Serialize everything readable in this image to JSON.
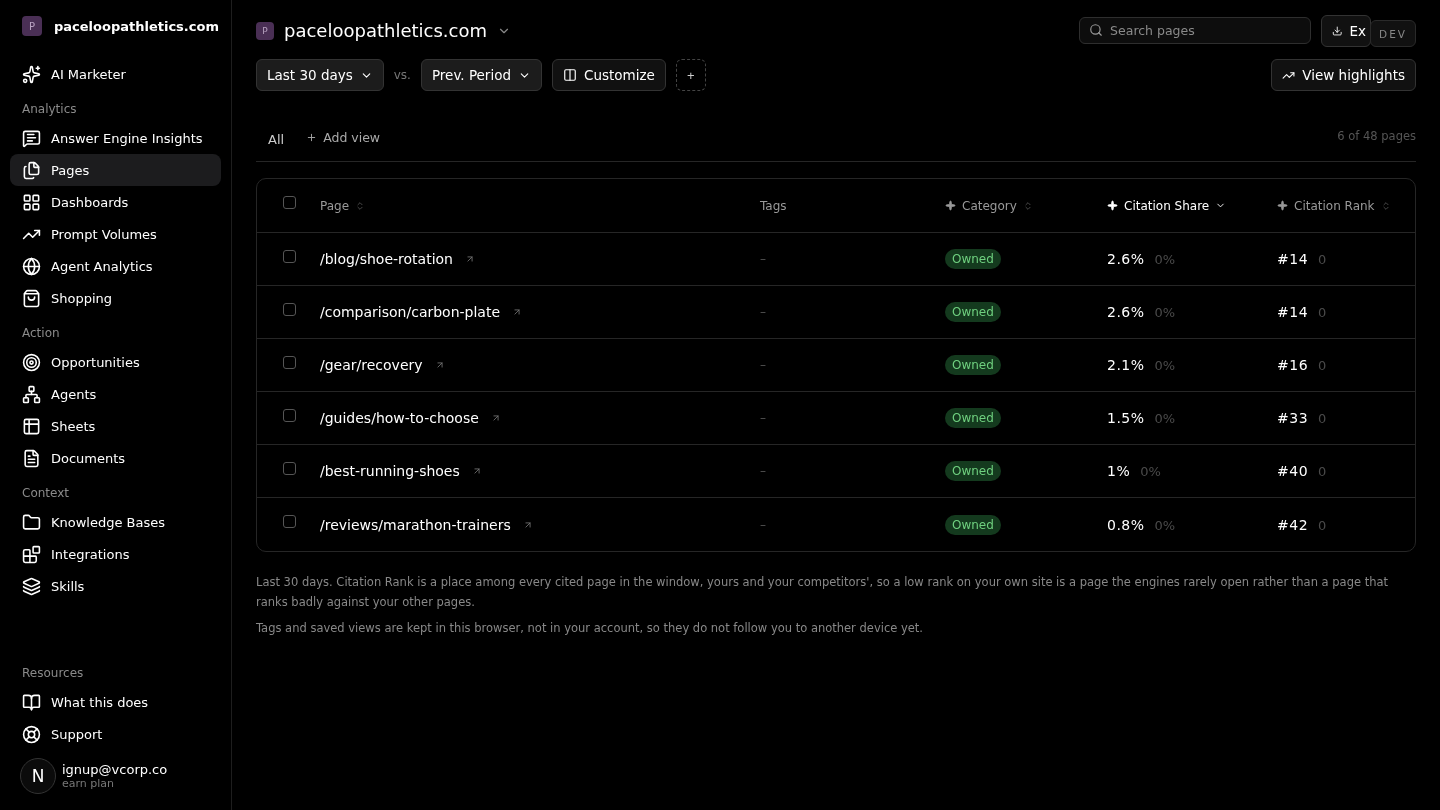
{
  "sidebar": {
    "workspace": {
      "initial": "P",
      "name": "paceloopathletics.com"
    },
    "top_item": {
      "label": "AI Marketer",
      "selected": false
    },
    "sections": [
      {
        "title": "Analytics",
        "items": [
          {
            "label": "Answer Engine Insights",
            "selected": false
          },
          {
            "label": "Pages",
            "selected": true
          },
          {
            "label": "Dashboards",
            "selected": false
          },
          {
            "label": "Prompt Volumes",
            "selected": false
          },
          {
            "label": "Agent Analytics",
            "selected": false
          },
          {
            "label": "Shopping",
            "selected": false
          }
        ]
      },
      {
        "title": "Action",
        "items": [
          {
            "label": "Opportunities",
            "selected": false
          },
          {
            "label": "Agents",
            "selected": false
          },
          {
            "label": "Sheets",
            "selected": false
          },
          {
            "label": "Documents",
            "selected": false
          }
        ]
      },
      {
        "title": "Context",
        "items": [
          {
            "label": "Knowledge Bases",
            "selected": false
          },
          {
            "label": "Integrations",
            "selected": false
          },
          {
            "label": "Skills",
            "selected": false
          }
        ]
      },
      {
        "title": "Resources",
        "items": [
          {
            "label": "What this does",
            "selected": false
          },
          {
            "label": "Support",
            "selected": false
          }
        ]
      }
    ],
    "user": {
      "avatar": "N",
      "email": "ignup@vcorp.co",
      "plan": "earn plan"
    }
  },
  "header": {
    "site_initial": "P",
    "site": "paceloopathletics.com",
    "search": {
      "placeholder": "Search pages"
    },
    "export_button": "Ex",
    "dev_badge": "DEV"
  },
  "toolbar": {
    "period": "Last 30 days",
    "vs": "vs.",
    "compare": "Prev. Period",
    "customize": "Customize",
    "add": "+",
    "highlights": "View highlights"
  },
  "views": {
    "tabs": [
      {
        "label": "All",
        "selected": true
      }
    ],
    "add_view": "Add view",
    "count": "6 of 48 pages"
  },
  "table": {
    "select_all": {
      "checked": false
    },
    "columns": [
      {
        "label": "Page",
        "kind": "sortable",
        "selected": false
      },
      {
        "label": "Tags",
        "kind": "plain",
        "selected": false
      },
      {
        "label": "Category",
        "kind": "metric",
        "selected": false
      },
      {
        "label": "Citation Share",
        "kind": "metric",
        "selected": true
      },
      {
        "label": "Citation Rank",
        "kind": "metric",
        "selected": false
      }
    ],
    "rows": [
      {
        "checked": false,
        "page": "/blog/shoe-rotation",
        "tags": "–",
        "category": "Owned",
        "share": "2.6%",
        "share_change": "0%",
        "rank": "#14",
        "rank_change": "0"
      },
      {
        "checked": false,
        "page": "/comparison/carbon-plate",
        "tags": "–",
        "category": "Owned",
        "share": "2.6%",
        "share_change": "0%",
        "rank": "#14",
        "rank_change": "0"
      },
      {
        "checked": false,
        "page": "/gear/recovery",
        "tags": "–",
        "category": "Owned",
        "share": "2.1%",
        "share_change": "0%",
        "rank": "#16",
        "rank_change": "0"
      },
      {
        "checked": false,
        "page": "/guides/how-to-choose",
        "tags": "–",
        "category": "Owned",
        "share": "1.5%",
        "share_change": "0%",
        "rank": "#33",
        "rank_change": "0"
      },
      {
        "checked": false,
        "page": "/best-running-shoes",
        "tags": "–",
        "category": "Owned",
        "share": "1%",
        "share_change": "0%",
        "rank": "#40",
        "rank_change": "0"
      },
      {
        "checked": false,
        "page": "/reviews/marathon-trainers",
        "tags": "–",
        "category": "Owned",
        "share": "0.8%",
        "share_change": "0%",
        "rank": "#42",
        "rank_change": "0"
      }
    ]
  },
  "notes": [
    "Last 30 days. Citation Rank is a place among every cited page in the window, yours and your competitors', so a low rank on your own site is a page the engines rarely open rather than a page that ranks badly against your other pages.",
    "Tags and saved views are kept in this browser, not in your account, so they do not follow you to another device yet."
  ]
}
